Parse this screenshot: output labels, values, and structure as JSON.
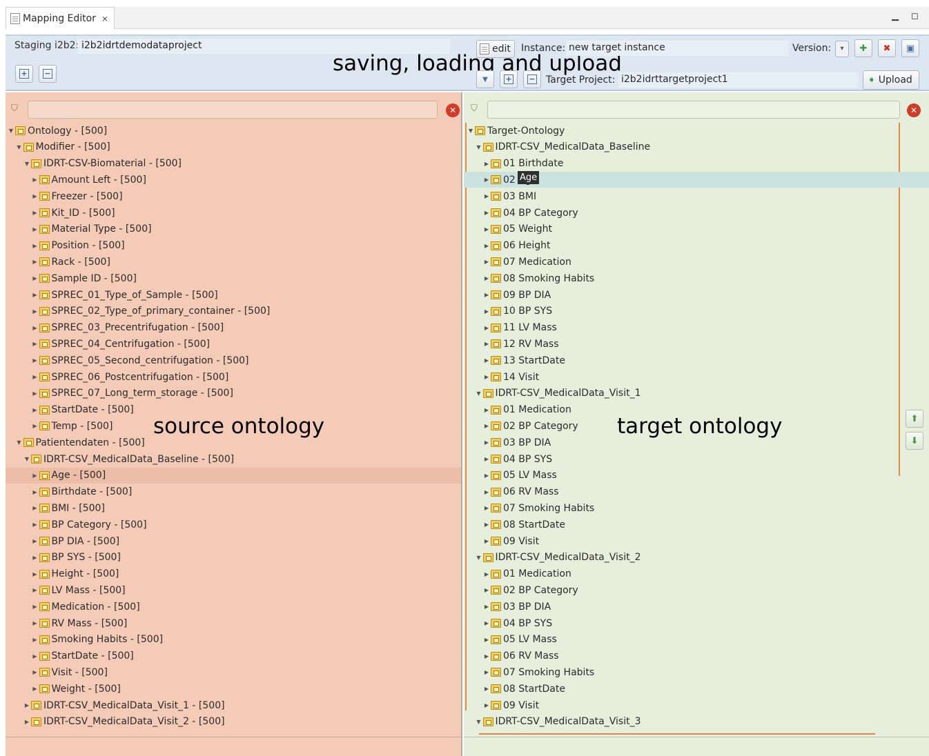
{
  "tab": {
    "title": "Mapping Editor",
    "close_glyph": "⨯"
  },
  "window": {
    "minimize_glyph": "▁",
    "maximize_glyph": "◻"
  },
  "header": {
    "staging_label": "Staging i2b2:",
    "staging_value": "i2b2idrtdemodataproject",
    "edit_label": "edit",
    "instance_label": "Instance:",
    "instance_value": "new target instance",
    "version_label": "Version:",
    "target_project_label": "Target Project:",
    "target_project_value": "i2b2idrttargetproject1",
    "upload_label": "Upload"
  },
  "annotations": {
    "header": "saving, loading and upload",
    "source": "source ontology",
    "target": "target ontology"
  },
  "tooltip": "Age",
  "source_tree": [
    {
      "indent": 0,
      "expanded": true,
      "label": "Ontology - [500]"
    },
    {
      "indent": 1,
      "expanded": true,
      "label": "Modifier - [500]"
    },
    {
      "indent": 2,
      "expanded": true,
      "label": "IDRT-CSV-Biomaterial - [500]"
    },
    {
      "indent": 3,
      "expanded": false,
      "label": "Amount Left - [500]"
    },
    {
      "indent": 3,
      "expanded": false,
      "label": "Freezer - [500]"
    },
    {
      "indent": 3,
      "expanded": false,
      "label": "Kit_ID - [500]"
    },
    {
      "indent": 3,
      "expanded": false,
      "label": "Material Type - [500]"
    },
    {
      "indent": 3,
      "expanded": false,
      "label": "Position - [500]"
    },
    {
      "indent": 3,
      "expanded": false,
      "label": "Rack - [500]"
    },
    {
      "indent": 3,
      "expanded": false,
      "label": "Sample ID - [500]"
    },
    {
      "indent": 3,
      "expanded": false,
      "label": "SPREC_01_Type_of_Sample - [500]"
    },
    {
      "indent": 3,
      "expanded": false,
      "label": "SPREC_02_Type_of_primary_container - [500]"
    },
    {
      "indent": 3,
      "expanded": false,
      "label": "SPREC_03_Precentrifugation - [500]"
    },
    {
      "indent": 3,
      "expanded": false,
      "label": "SPREC_04_Centrifugation - [500]"
    },
    {
      "indent": 3,
      "expanded": false,
      "label": "SPREC_05_Second_centrifugation - [500]"
    },
    {
      "indent": 3,
      "expanded": false,
      "label": "SPREC_06_Postcentrifugation - [500]"
    },
    {
      "indent": 3,
      "expanded": false,
      "label": "SPREC_07_Long_term_storage - [500]"
    },
    {
      "indent": 3,
      "expanded": false,
      "label": "StartDate - [500]"
    },
    {
      "indent": 3,
      "expanded": false,
      "label": "Temp - [500]"
    },
    {
      "indent": 1,
      "expanded": true,
      "label": "Patientendaten - [500]"
    },
    {
      "indent": 2,
      "expanded": true,
      "label": "IDRT-CSV_MedicalData_Baseline - [500]"
    },
    {
      "indent": 3,
      "expanded": false,
      "label": "Age - [500]",
      "highlight": true
    },
    {
      "indent": 3,
      "expanded": false,
      "label": "Birthdate - [500]"
    },
    {
      "indent": 3,
      "expanded": false,
      "label": "BMI - [500]"
    },
    {
      "indent": 3,
      "expanded": false,
      "label": "BP Category - [500]"
    },
    {
      "indent": 3,
      "expanded": false,
      "label": "BP DIA - [500]"
    },
    {
      "indent": 3,
      "expanded": false,
      "label": "BP SYS - [500]"
    },
    {
      "indent": 3,
      "expanded": false,
      "label": "Height - [500]"
    },
    {
      "indent": 3,
      "expanded": false,
      "label": "LV Mass - [500]"
    },
    {
      "indent": 3,
      "expanded": false,
      "label": "Medication - [500]"
    },
    {
      "indent": 3,
      "expanded": false,
      "label": "RV Mass - [500]"
    },
    {
      "indent": 3,
      "expanded": false,
      "label": "Smoking Habits - [500]"
    },
    {
      "indent": 3,
      "expanded": false,
      "label": "StartDate - [500]"
    },
    {
      "indent": 3,
      "expanded": false,
      "label": "Visit - [500]"
    },
    {
      "indent": 3,
      "expanded": false,
      "label": "Weight - [500]"
    },
    {
      "indent": 2,
      "expanded": false,
      "label": "IDRT-CSV_MedicalData_Visit_1 - [500]"
    },
    {
      "indent": 2,
      "expanded": false,
      "label": "IDRT-CSV_MedicalData_Visit_2 - [500]"
    }
  ],
  "target_tree": [
    {
      "indent": 0,
      "expanded": true,
      "label": "Target-Ontology"
    },
    {
      "indent": 1,
      "expanded": true,
      "label": "IDRT-CSV_MedicalData_Baseline"
    },
    {
      "indent": 2,
      "expanded": false,
      "label": "01 Birthdate"
    },
    {
      "indent": 2,
      "expanded": false,
      "label": "02 Age",
      "highlight": true
    },
    {
      "indent": 2,
      "expanded": false,
      "label": "03 BMI"
    },
    {
      "indent": 2,
      "expanded": false,
      "label": "04 BP Category"
    },
    {
      "indent": 2,
      "expanded": false,
      "label": "05 Weight"
    },
    {
      "indent": 2,
      "expanded": false,
      "label": "06 Height"
    },
    {
      "indent": 2,
      "expanded": false,
      "label": "07 Medication"
    },
    {
      "indent": 2,
      "expanded": false,
      "label": "08 Smoking Habits"
    },
    {
      "indent": 2,
      "expanded": false,
      "label": "09 BP DIA"
    },
    {
      "indent": 2,
      "expanded": false,
      "label": "10 BP SYS"
    },
    {
      "indent": 2,
      "expanded": false,
      "label": "11 LV Mass"
    },
    {
      "indent": 2,
      "expanded": false,
      "label": "12 RV Mass"
    },
    {
      "indent": 2,
      "expanded": false,
      "label": "13 StartDate"
    },
    {
      "indent": 2,
      "expanded": false,
      "label": "14 Visit"
    },
    {
      "indent": 1,
      "expanded": true,
      "label": "IDRT-CSV_MedicalData_Visit_1"
    },
    {
      "indent": 2,
      "expanded": false,
      "label": "01 Medication"
    },
    {
      "indent": 2,
      "expanded": false,
      "label": "02 BP Category"
    },
    {
      "indent": 2,
      "expanded": false,
      "label": "03 BP DIA"
    },
    {
      "indent": 2,
      "expanded": false,
      "label": "04 BP SYS"
    },
    {
      "indent": 2,
      "expanded": false,
      "label": "05 LV Mass"
    },
    {
      "indent": 2,
      "expanded": false,
      "label": "06 RV Mass"
    },
    {
      "indent": 2,
      "expanded": false,
      "label": "07 Smoking Habits"
    },
    {
      "indent": 2,
      "expanded": false,
      "label": "08 StartDate"
    },
    {
      "indent": 2,
      "expanded": false,
      "label": "09 Visit"
    },
    {
      "indent": 1,
      "expanded": true,
      "label": "IDRT-CSV_MedicalData_Visit_2"
    },
    {
      "indent": 2,
      "expanded": false,
      "label": "01 Medication"
    },
    {
      "indent": 2,
      "expanded": false,
      "label": "02 BP Category"
    },
    {
      "indent": 2,
      "expanded": false,
      "label": "03 BP DIA"
    },
    {
      "indent": 2,
      "expanded": false,
      "label": "04 BP SYS"
    },
    {
      "indent": 2,
      "expanded": false,
      "label": "05 LV Mass"
    },
    {
      "indent": 2,
      "expanded": false,
      "label": "06 RV Mass"
    },
    {
      "indent": 2,
      "expanded": false,
      "label": "07 Smoking Habits"
    },
    {
      "indent": 2,
      "expanded": false,
      "label": "08 StartDate"
    },
    {
      "indent": 2,
      "expanded": false,
      "label": "09 Visit"
    },
    {
      "indent": 1,
      "expanded": true,
      "label": "IDRT-CSV_MedicalData_Visit_3"
    }
  ],
  "colors": {
    "source_bg": "#f4cbb6",
    "target_bg": "#e5efdc",
    "header_bg": "#dce7f2",
    "accent_orange": "#e68845"
  }
}
